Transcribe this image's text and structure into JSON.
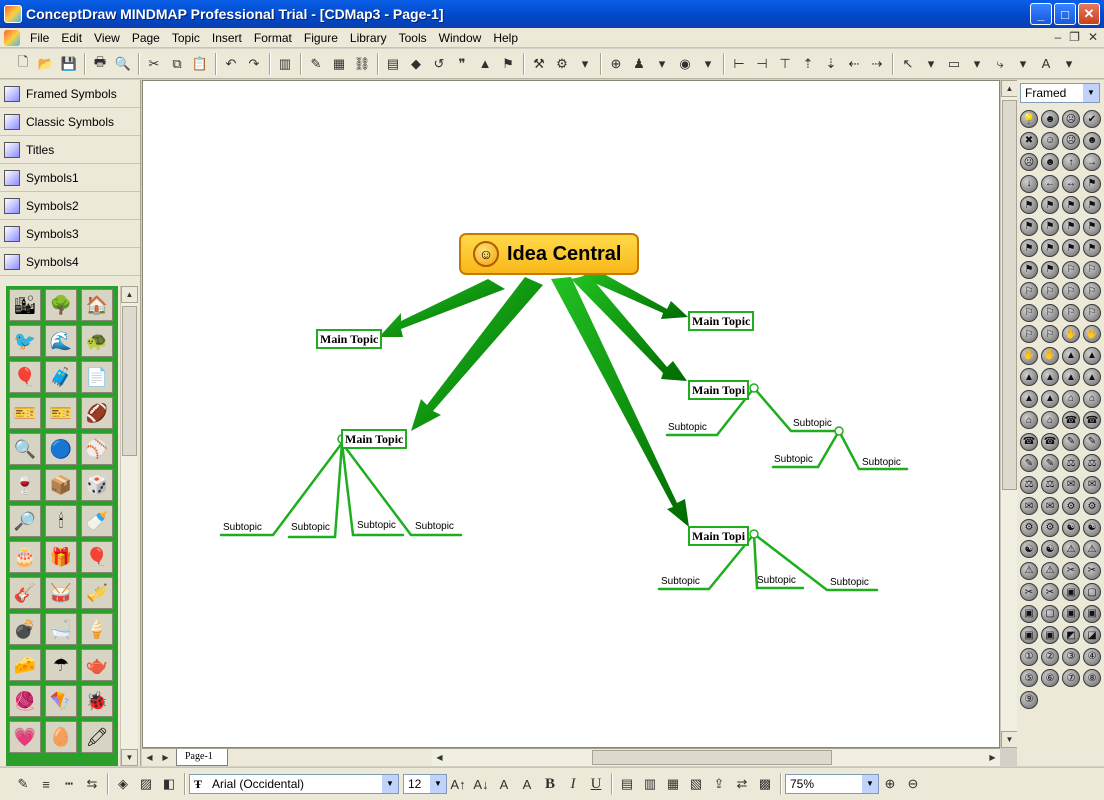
{
  "window": {
    "title": "ConceptDraw MINDMAP Professional Trial - [CDMap3 - Page-1]"
  },
  "menu": [
    "File",
    "Edit",
    "View",
    "Page",
    "Topic",
    "Insert",
    "Format",
    "Figure",
    "Library",
    "Tools",
    "Window",
    "Help"
  ],
  "library_tabs": [
    "Framed Symbols",
    "Classic Symbols",
    "Titles",
    "Symbols1",
    "Symbols2",
    "Symbols3",
    "Symbols4"
  ],
  "right_panel": {
    "style_select": "Framed"
  },
  "map": {
    "central": "Idea Central",
    "main_topic_label": "Main Topic",
    "main_topic_short": "Main Topi",
    "subtopic_label": "Subtopic"
  },
  "page_tab": "Page-1",
  "format": {
    "font": "Arial (Occidental)",
    "size": "12",
    "zoom": "75%",
    "bold": "B",
    "italic": "I",
    "underline": "U"
  },
  "colors": {
    "topic_border": "#1fae1f",
    "arrow_light": "#22c222",
    "arrow_dark": "#006a00",
    "central_fill": "#f9b81a"
  }
}
